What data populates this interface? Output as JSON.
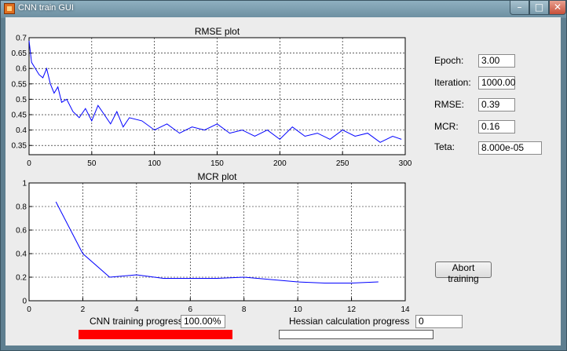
{
  "window": {
    "title": "CNN train GUI",
    "min_glyph": "–",
    "max_glyph": "□",
    "close_glyph": "✕"
  },
  "stats": {
    "epoch_label": "Epoch:",
    "epoch_value": "3.00",
    "iteration_label": "Iteration:",
    "iteration_value": "1000.00",
    "rmse_label": "RMSE:",
    "rmse_value": "0.39",
    "mcr_label": "MCR:",
    "mcr_value": "0.16",
    "teta_label": "Teta:",
    "teta_value": "8.000e-05"
  },
  "abort_label": "Abort training",
  "progress": {
    "cnn_label": "CNN training progress",
    "cnn_value": "100.00%",
    "cnn_fraction": 1.0,
    "hessian_label": "Hessian calculation progress",
    "hessian_value": "0",
    "hessian_fraction": 0.0
  },
  "colors": {
    "line": "#0000ff",
    "progress": "#ff0000",
    "grid": "#000000"
  },
  "chart_data": [
    {
      "type": "line",
      "title": "RMSE plot",
      "xlim": [
        0,
        300
      ],
      "ylim": [
        0.32,
        0.7
      ],
      "xticks": [
        0,
        50,
        100,
        150,
        200,
        250,
        300
      ],
      "yticks": [
        0.35,
        0.4,
        0.45,
        0.5,
        0.55,
        0.6,
        0.65,
        0.7
      ],
      "ytick_labels": [
        "0.35",
        "0.4",
        "0.45",
        "0.5",
        "0.55",
        "0.6",
        "0.65",
        "0.7"
      ],
      "grid": true,
      "series": [
        {
          "x": [
            0,
            2,
            5,
            8,
            11,
            14,
            17,
            20,
            23,
            26,
            30,
            35,
            40,
            45,
            50,
            55,
            60,
            65,
            70,
            75,
            80,
            90,
            100,
            110,
            120,
            130,
            140,
            150,
            160,
            170,
            180,
            190,
            200,
            210,
            220,
            230,
            240,
            250,
            260,
            270,
            280,
            290,
            297
          ],
          "y": [
            0.69,
            0.62,
            0.6,
            0.58,
            0.57,
            0.6,
            0.55,
            0.52,
            0.54,
            0.49,
            0.5,
            0.46,
            0.44,
            0.47,
            0.43,
            0.48,
            0.45,
            0.42,
            0.46,
            0.41,
            0.44,
            0.43,
            0.4,
            0.42,
            0.39,
            0.41,
            0.4,
            0.42,
            0.39,
            0.4,
            0.38,
            0.4,
            0.37,
            0.41,
            0.38,
            0.39,
            0.37,
            0.4,
            0.38,
            0.39,
            0.36,
            0.38,
            0.37
          ]
        }
      ]
    },
    {
      "type": "line",
      "title": "MCR plot",
      "xlim": [
        0,
        14
      ],
      "ylim": [
        0,
        1
      ],
      "xticks": [
        0,
        2,
        4,
        6,
        8,
        10,
        12,
        14
      ],
      "yticks": [
        0,
        0.2,
        0.4,
        0.6,
        0.8,
        1
      ],
      "ytick_labels": [
        "0",
        "0.2",
        "0.4",
        "0.6",
        "0.8",
        "1"
      ],
      "grid": true,
      "series": [
        {
          "x": [
            1,
            2,
            3,
            4,
            5,
            6,
            7,
            8,
            9,
            10,
            11,
            12,
            13
          ],
          "y": [
            0.84,
            0.4,
            0.2,
            0.22,
            0.19,
            0.19,
            0.19,
            0.2,
            0.18,
            0.16,
            0.15,
            0.15,
            0.16
          ]
        }
      ]
    }
  ]
}
